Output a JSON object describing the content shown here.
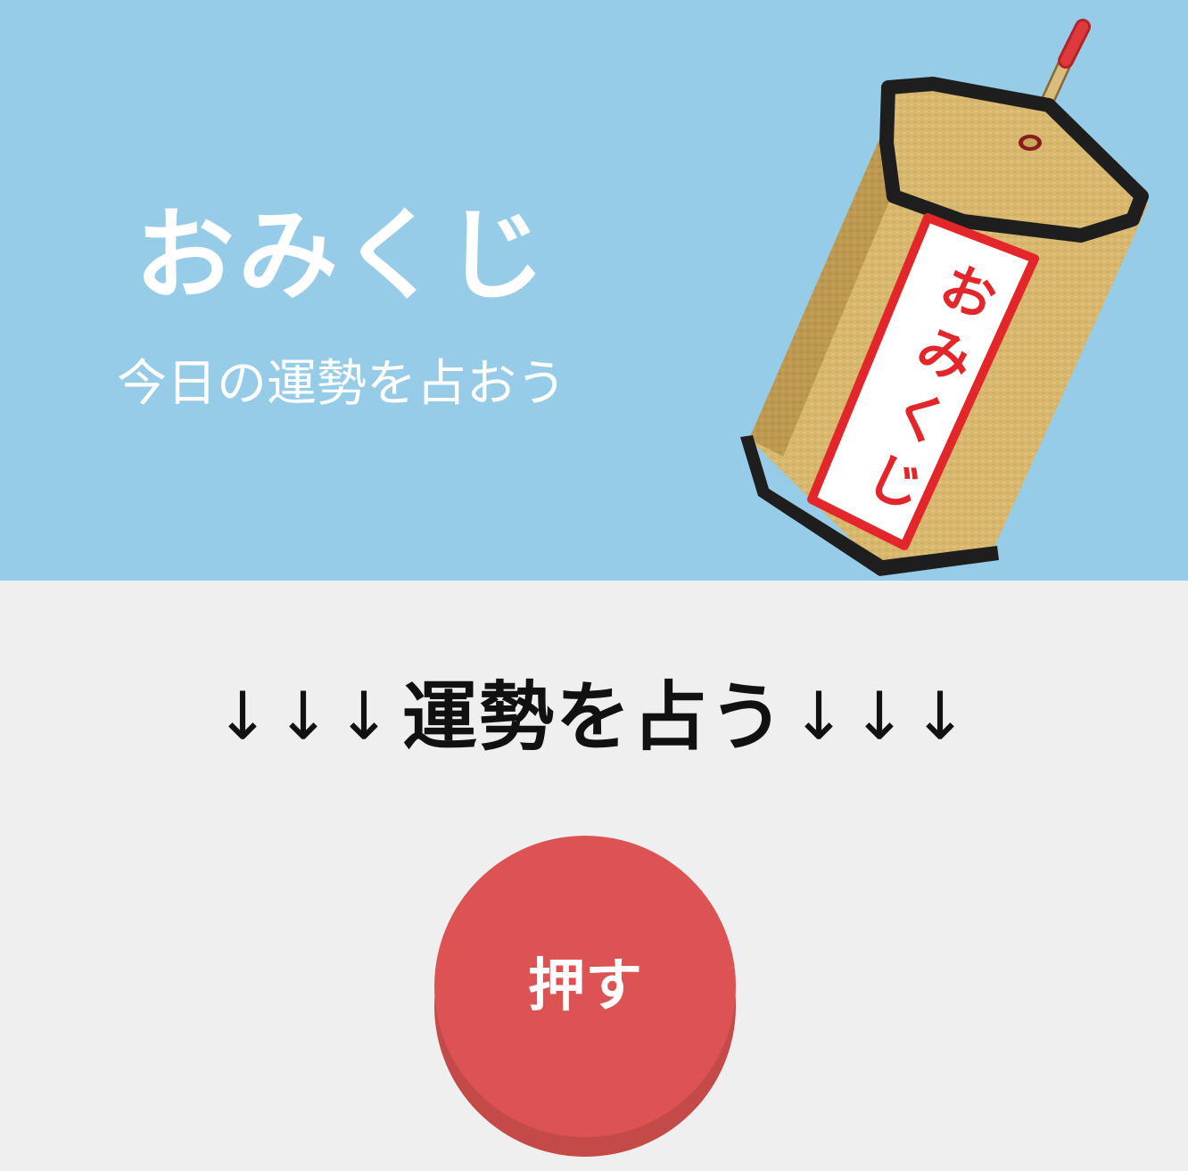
{
  "hero": {
    "title": "おみくじ",
    "subtitle": "今日の運勢を占おう",
    "illustration": {
      "label_text": "おみくじ",
      "background_color": "#97cce8"
    }
  },
  "main": {
    "arrows_left": "↓↓↓",
    "prompt_text": "運勢を占う",
    "arrows_right": "↓↓↓",
    "button_label": "押す",
    "button_color": "#dd5354",
    "background_color": "#efefef"
  }
}
